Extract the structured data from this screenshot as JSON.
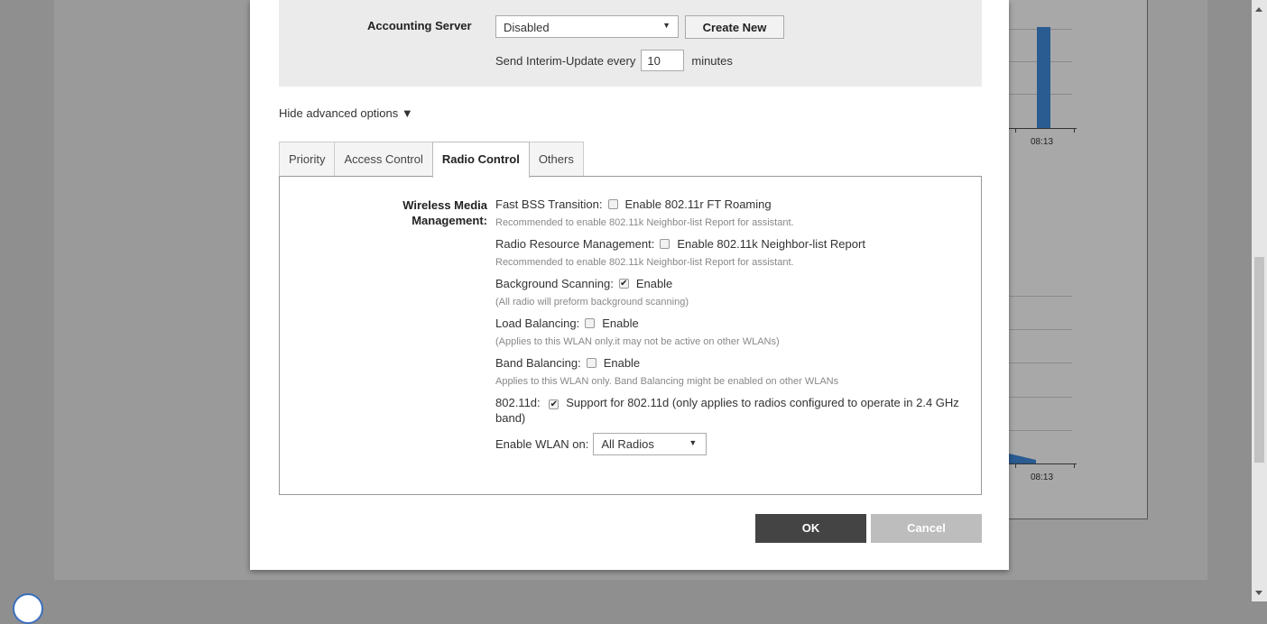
{
  "accounting": {
    "label": "Accounting Server",
    "server_value": "Disabled",
    "create_new_label": "Create New",
    "interim_prefix": "Send Interim-Update every",
    "interim_value": "10",
    "interim_suffix": "minutes"
  },
  "advanced_toggle": "Hide advanced options ▼",
  "tabs": [
    {
      "label": "Priority",
      "active": false
    },
    {
      "label": "Access Control",
      "active": false
    },
    {
      "label": "Radio Control",
      "active": true
    },
    {
      "label": "Others",
      "active": false
    }
  ],
  "radio_control": {
    "section_label": "Wireless Media Management:",
    "fast_bss": {
      "label": "Fast BSS Transition:",
      "checked": false,
      "option": "Enable 802.11r FT Roaming",
      "note": "Recommended to enable 802.11k Neighbor-list Report for assistant."
    },
    "rrm": {
      "label": "Radio Resource Management:",
      "checked": false,
      "option": "Enable 802.11k Neighbor-list Report",
      "note": "Recommended to enable 802.11k Neighbor-list Report for assistant."
    },
    "bg_scan": {
      "label": "Background Scanning:",
      "checked": true,
      "option": "Enable",
      "note": "(All radio will preform background scanning)"
    },
    "load_bal": {
      "label": "Load Balancing:",
      "checked": false,
      "option": "Enable",
      "note": "(Applies to this WLAN only.it may not be active on other WLANs)"
    },
    "band_bal": {
      "label": "Band Balancing:",
      "checked": false,
      "option": "Enable",
      "note": "Applies to this WLAN only. Band Balancing might be enabled on other WLANs"
    },
    "d80211": {
      "label": "802.11d:",
      "checked": true,
      "option": "Support for 802.11d (only applies to radios configured to operate in 2.4 GHz band)"
    },
    "enable_wlan": {
      "label": "Enable WLAN on:",
      "value": "All Radios"
    }
  },
  "buttons": {
    "ok": "OK",
    "cancel": "Cancel"
  },
  "background": {
    "time_top": "08:13",
    "time_bottom": "08:13"
  },
  "colors": {
    "bar": "#2a5b91",
    "ok_bg": "#444444",
    "cancel_bg": "#bdbdbd"
  }
}
